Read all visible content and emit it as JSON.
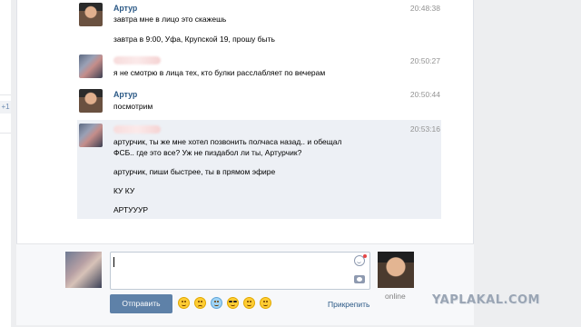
{
  "sidebar": {
    "badge": "+1"
  },
  "messages": [
    {
      "author": "Артур",
      "time": "20:48:38",
      "lines": [
        "завтра мне в лицо это скажешь",
        "завтра в 9:00, Уфа, Крупской 19, прошу быть"
      ]
    },
    {
      "author": "",
      "time": "20:50:27",
      "lines": [
        "я не смотрю в лица тех, кто булки расслабляет по вечерам"
      ]
    },
    {
      "author": "Артур",
      "time": "20:50:44",
      "lines": [
        "посмотрим"
      ]
    },
    {
      "author": "",
      "time": "20:53:16",
      "lines": [
        "артурчик, ты же мне хотел позвонить полчаса назад.. и обещал",
        "ФСБ.. где это все? Уж не пиздабол ли ты, Артурчик?",
        "артурчик, пиши быстрее, ты в прямом эфире",
        "КУ КУ",
        "АРТУУУР"
      ]
    }
  ],
  "composer": {
    "input_value": "",
    "send_label": "Отправить",
    "attach_label": "Прикрепить",
    "emoji_icons": [
      "grin-emoji-icon",
      "sweat-emoji-icon",
      "teary-emoji-icon",
      "cool-emoji-icon",
      "smile-emoji-icon",
      "blush-emoji-icon"
    ]
  },
  "peer": {
    "status": "online"
  },
  "watermark": "YAPLAKAL.COM",
  "colors": {
    "accent": "#5e81a8",
    "link": "#2a5885",
    "highlight": "#edf0f5"
  }
}
